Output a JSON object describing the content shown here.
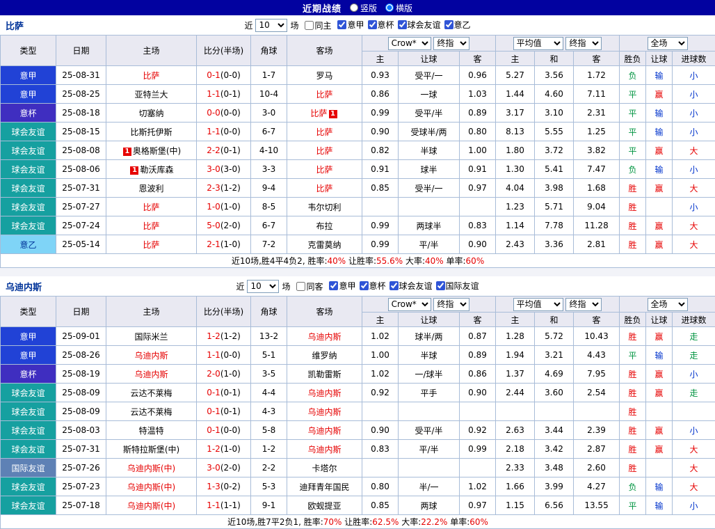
{
  "topbar": {
    "title": "近期战绩",
    "options": [
      {
        "label": "竖版",
        "selected": false
      },
      {
        "label": "横版",
        "selected": true
      }
    ]
  },
  "filter_labels": {
    "near": "近",
    "count": "10",
    "games": "场"
  },
  "table_header": {
    "type": "类型",
    "date": "日期",
    "home": "主场",
    "score": "比分(半场)",
    "corner": "角球",
    "away": "客场",
    "odds_group": [
      "Crow*",
      "终指"
    ],
    "avg_group": [
      "平均值",
      "终指"
    ],
    "full_select": "全场",
    "sub": [
      "主",
      "让球",
      "客",
      "主",
      "和",
      "客",
      "胜负",
      "让球",
      "进球数"
    ]
  },
  "colors": {
    "topbar_bg": "#0202a0",
    "header_bg": "#e9e9f2",
    "border": "#a8bcd8",
    "accent_red": "#e60000",
    "team_navy": "#003399",
    "check_blue": "#2f54d6"
  },
  "type_colors": {
    "意甲": {
      "bg": "#2142d6",
      "fg": "#ffffff"
    },
    "意杯": {
      "bg": "#3f2ec0",
      "fg": "#ffffff"
    },
    "球会友谊": {
      "bg": "#16a0a0",
      "fg": "#ffffff"
    },
    "意乙": {
      "bg": "#7fd4f7",
      "fg": "#00349a"
    },
    "国际友谊": {
      "bg": "#5e81b5",
      "fg": "#ffffff"
    }
  },
  "result_colors": {
    "胜": "#e60000",
    "平": "#009440",
    "负": "#009440",
    "赢": "#e60000",
    "输": "#0033cc",
    "大": "#e60000",
    "小": "#0033cc",
    "走": "#009440"
  },
  "sections": [
    {
      "team": "比萨",
      "same_option": "同主",
      "leagues": [
        "意甲",
        "意杯",
        "球会友谊",
        "意乙"
      ],
      "rows": [
        {
          "type": "意甲",
          "date": "25-08-31",
          "home": "比萨",
          "home_red": true,
          "score": "0-1",
          "half": "(0-0)",
          "corner": "1-7",
          "away": "罗马",
          "o1": "0.93",
          "hd": "受平/一",
          "o2": "0.96",
          "a1": "5.27",
          "a2": "3.56",
          "a3": "1.72",
          "r1": "负",
          "r2": "输",
          "r3": "小"
        },
        {
          "type": "意甲",
          "date": "25-08-25",
          "home": "亚特兰大",
          "score": "1-1",
          "half": "(0-1)",
          "corner": "10-4",
          "away": "比萨",
          "away_red": true,
          "o1": "0.86",
          "hd": "一球",
          "o2": "1.03",
          "a1": "1.44",
          "a2": "4.60",
          "a3": "7.11",
          "r1": "平",
          "r2": "赢",
          "r3": "小"
        },
        {
          "type": "意杯",
          "date": "25-08-18",
          "home": "切塞纳",
          "score": "0-0",
          "half": "(0-0)",
          "corner": "3-0",
          "away": "比萨",
          "away_red": true,
          "away_badge": "1",
          "away_badge_pos": "after",
          "o1": "0.99",
          "hd": "受平/半",
          "o2": "0.89",
          "a1": "3.17",
          "a2": "3.10",
          "a3": "2.31",
          "r1": "平",
          "r2": "输",
          "r3": "小"
        },
        {
          "type": "球会友谊",
          "date": "25-08-15",
          "home": "比斯托伊斯",
          "score": "1-1",
          "half": "(0-0)",
          "corner": "6-7",
          "away": "比萨",
          "away_red": true,
          "o1": "0.90",
          "hd": "受球半/两",
          "o2": "0.80",
          "a1": "8.13",
          "a2": "5.55",
          "a3": "1.25",
          "r1": "平",
          "r2": "输",
          "r3": "小"
        },
        {
          "type": "球会友谊",
          "date": "25-08-08",
          "home": "奥格斯堡(中)",
          "home_badge": "1",
          "home_badge_pos": "before",
          "score": "2-2",
          "half": "(0-1)",
          "corner": "4-10",
          "away": "比萨",
          "away_red": true,
          "o1": "0.82",
          "hd": "半球",
          "o2": "1.00",
          "a1": "1.80",
          "a2": "3.72",
          "a3": "3.82",
          "r1": "平",
          "r2": "赢",
          "r3": "大"
        },
        {
          "type": "球会友谊",
          "date": "25-08-06",
          "home": "勒沃库森",
          "home_badge": "1",
          "home_badge_pos": "before",
          "score": "3-0",
          "half": "(3-0)",
          "corner": "3-3",
          "away": "比萨",
          "away_red": true,
          "o1": "0.91",
          "hd": "球半",
          "o2": "0.91",
          "a1": "1.30",
          "a2": "5.41",
          "a3": "7.47",
          "r1": "负",
          "r2": "输",
          "r3": "小"
        },
        {
          "type": "球会友谊",
          "date": "25-07-31",
          "home": "恩波利",
          "score": "2-3",
          "half": "(1-2)",
          "corner": "9-4",
          "away": "比萨",
          "away_red": true,
          "o1": "0.85",
          "hd": "受半/一",
          "o2": "0.97",
          "a1": "4.04",
          "a2": "3.98",
          "a3": "1.68",
          "r1": "胜",
          "r2": "赢",
          "r3": "大"
        },
        {
          "type": "球会友谊",
          "date": "25-07-27",
          "home": "比萨",
          "home_red": true,
          "score": "1-0",
          "half": "(1-0)",
          "corner": "8-5",
          "away": "韦尔切利",
          "o1": "",
          "hd": "",
          "o2": "",
          "a1": "1.23",
          "a2": "5.71",
          "a3": "9.04",
          "r1": "胜",
          "r2": "",
          "r3": "小"
        },
        {
          "type": "球会友谊",
          "date": "25-07-24",
          "home": "比萨",
          "home_red": true,
          "score": "5-0",
          "half": "(2-0)",
          "corner": "6-7",
          "away": "布拉",
          "o1": "0.99",
          "hd": "两球半",
          "o2": "0.83",
          "a1": "1.14",
          "a2": "7.78",
          "a3": "11.28",
          "r1": "胜",
          "r2": "赢",
          "r3": "大"
        },
        {
          "type": "意乙",
          "date": "25-05-14",
          "home": "比萨",
          "home_red": true,
          "score": "2-1",
          "half": "(1-0)",
          "corner": "7-2",
          "away": "克雷莫纳",
          "o1": "0.99",
          "hd": "平/半",
          "o2": "0.90",
          "a1": "2.43",
          "a2": "3.36",
          "a3": "2.81",
          "r1": "胜",
          "r2": "赢",
          "r3": "大"
        }
      ],
      "summary": {
        "prefix": "近10场,胜4平4负2,",
        "stats": [
          {
            "label": "胜率:",
            "value": "40%"
          },
          {
            "label": "让胜率:",
            "value": "55.6%"
          },
          {
            "label": "大率:",
            "value": "40%"
          },
          {
            "label": "单率:",
            "value": "60%"
          }
        ]
      }
    },
    {
      "team": "乌迪内斯",
      "same_option": "同客",
      "leagues": [
        "意甲",
        "意杯",
        "球会友谊",
        "国际友谊"
      ],
      "rows": [
        {
          "type": "意甲",
          "date": "25-09-01",
          "home": "国际米兰",
          "score": "1-2",
          "half": "(1-2)",
          "corner": "13-2",
          "away": "乌迪内斯",
          "away_red": true,
          "o1": "1.02",
          "hd": "球半/两",
          "o2": "0.87",
          "a1": "1.28",
          "a2": "5.72",
          "a3": "10.43",
          "r1": "胜",
          "r2": "赢",
          "r3": "走"
        },
        {
          "type": "意甲",
          "date": "25-08-26",
          "home": "乌迪内斯",
          "home_red": true,
          "score": "1-1",
          "half": "(0-0)",
          "corner": "5-1",
          "away": "维罗纳",
          "o1": "1.00",
          "hd": "半球",
          "o2": "0.89",
          "a1": "1.94",
          "a2": "3.21",
          "a3": "4.43",
          "r1": "平",
          "r2": "输",
          "r3": "走"
        },
        {
          "type": "意杯",
          "date": "25-08-19",
          "home": "乌迪内斯",
          "home_red": true,
          "score": "2-0",
          "half": "(1-0)",
          "corner": "3-5",
          "away": "凯勒雷斯",
          "o1": "1.02",
          "hd": "一/球半",
          "o2": "0.86",
          "a1": "1.37",
          "a2": "4.69",
          "a3": "7.95",
          "r1": "胜",
          "r2": "赢",
          "r3": "小"
        },
        {
          "type": "球会友谊",
          "date": "25-08-09",
          "home": "云达不莱梅",
          "score": "0-1",
          "half": "(0-1)",
          "corner": "4-4",
          "away": "乌迪内斯",
          "away_red": true,
          "o1": "0.92",
          "hd": "平手",
          "o2": "0.90",
          "a1": "2.44",
          "a2": "3.60",
          "a3": "2.54",
          "r1": "胜",
          "r2": "赢",
          "r3": "走"
        },
        {
          "type": "球会友谊",
          "date": "25-08-09",
          "home": "云达不莱梅",
          "score": "0-1",
          "half": "(0-1)",
          "corner": "4-3",
          "away": "乌迪内斯",
          "away_red": true,
          "o1": "",
          "hd": "",
          "o2": "",
          "a1": "",
          "a2": "",
          "a3": "",
          "r1": "胜",
          "r2": "",
          "r3": ""
        },
        {
          "type": "球会友谊",
          "date": "25-08-03",
          "home": "特温特",
          "score": "0-1",
          "half": "(0-0)",
          "corner": "5-8",
          "away": "乌迪内斯",
          "away_red": true,
          "o1": "0.90",
          "hd": "受平/半",
          "o2": "0.92",
          "a1": "2.63",
          "a2": "3.44",
          "a3": "2.39",
          "r1": "胜",
          "r2": "赢",
          "r3": "小"
        },
        {
          "type": "球会友谊",
          "date": "25-07-31",
          "home": "斯特拉斯堡(中)",
          "score": "1-2",
          "half": "(1-0)",
          "corner": "1-2",
          "away": "乌迪内斯",
          "away_red": true,
          "o1": "0.83",
          "hd": "平/半",
          "o2": "0.99",
          "a1": "2.18",
          "a2": "3.42",
          "a3": "2.87",
          "r1": "胜",
          "r2": "赢",
          "r3": "大"
        },
        {
          "type": "国际友谊",
          "date": "25-07-26",
          "home": "乌迪内斯(中)",
          "home_red": true,
          "score": "3-0",
          "half": "(2-0)",
          "corner": "2-2",
          "away": "卡塔尔",
          "o1": "",
          "hd": "",
          "o2": "",
          "a1": "2.33",
          "a2": "3.48",
          "a3": "2.60",
          "r1": "胜",
          "r2": "",
          "r3": "大"
        },
        {
          "type": "球会友谊",
          "date": "25-07-23",
          "home": "乌迪内斯(中)",
          "home_red": true,
          "score": "1-3",
          "half": "(0-2)",
          "corner": "5-3",
          "away": "迪拜青年国民",
          "o1": "0.80",
          "hd": "半/一",
          "o2": "1.02",
          "a1": "1.66",
          "a2": "3.99",
          "a3": "4.27",
          "r1": "负",
          "r2": "输",
          "r3": "大"
        },
        {
          "type": "球会友谊",
          "date": "25-07-18",
          "home": "乌迪内斯(中)",
          "home_red": true,
          "score": "1-1",
          "half": "(1-1)",
          "corner": "9-1",
          "away": "欧蚬提亚",
          "o1": "0.85",
          "hd": "两球",
          "o2": "0.97",
          "a1": "1.15",
          "a2": "6.56",
          "a3": "13.55",
          "r1": "平",
          "r2": "输",
          "r3": "小"
        }
      ],
      "summary": {
        "prefix": "近10场,胜7平2负1,",
        "stats": [
          {
            "label": "胜率:",
            "value": "70%"
          },
          {
            "label": "让胜率:",
            "value": "62.5%"
          },
          {
            "label": "大率:",
            "value": "22.2%"
          },
          {
            "label": "单率:",
            "value": "60%"
          }
        ]
      }
    }
  ]
}
